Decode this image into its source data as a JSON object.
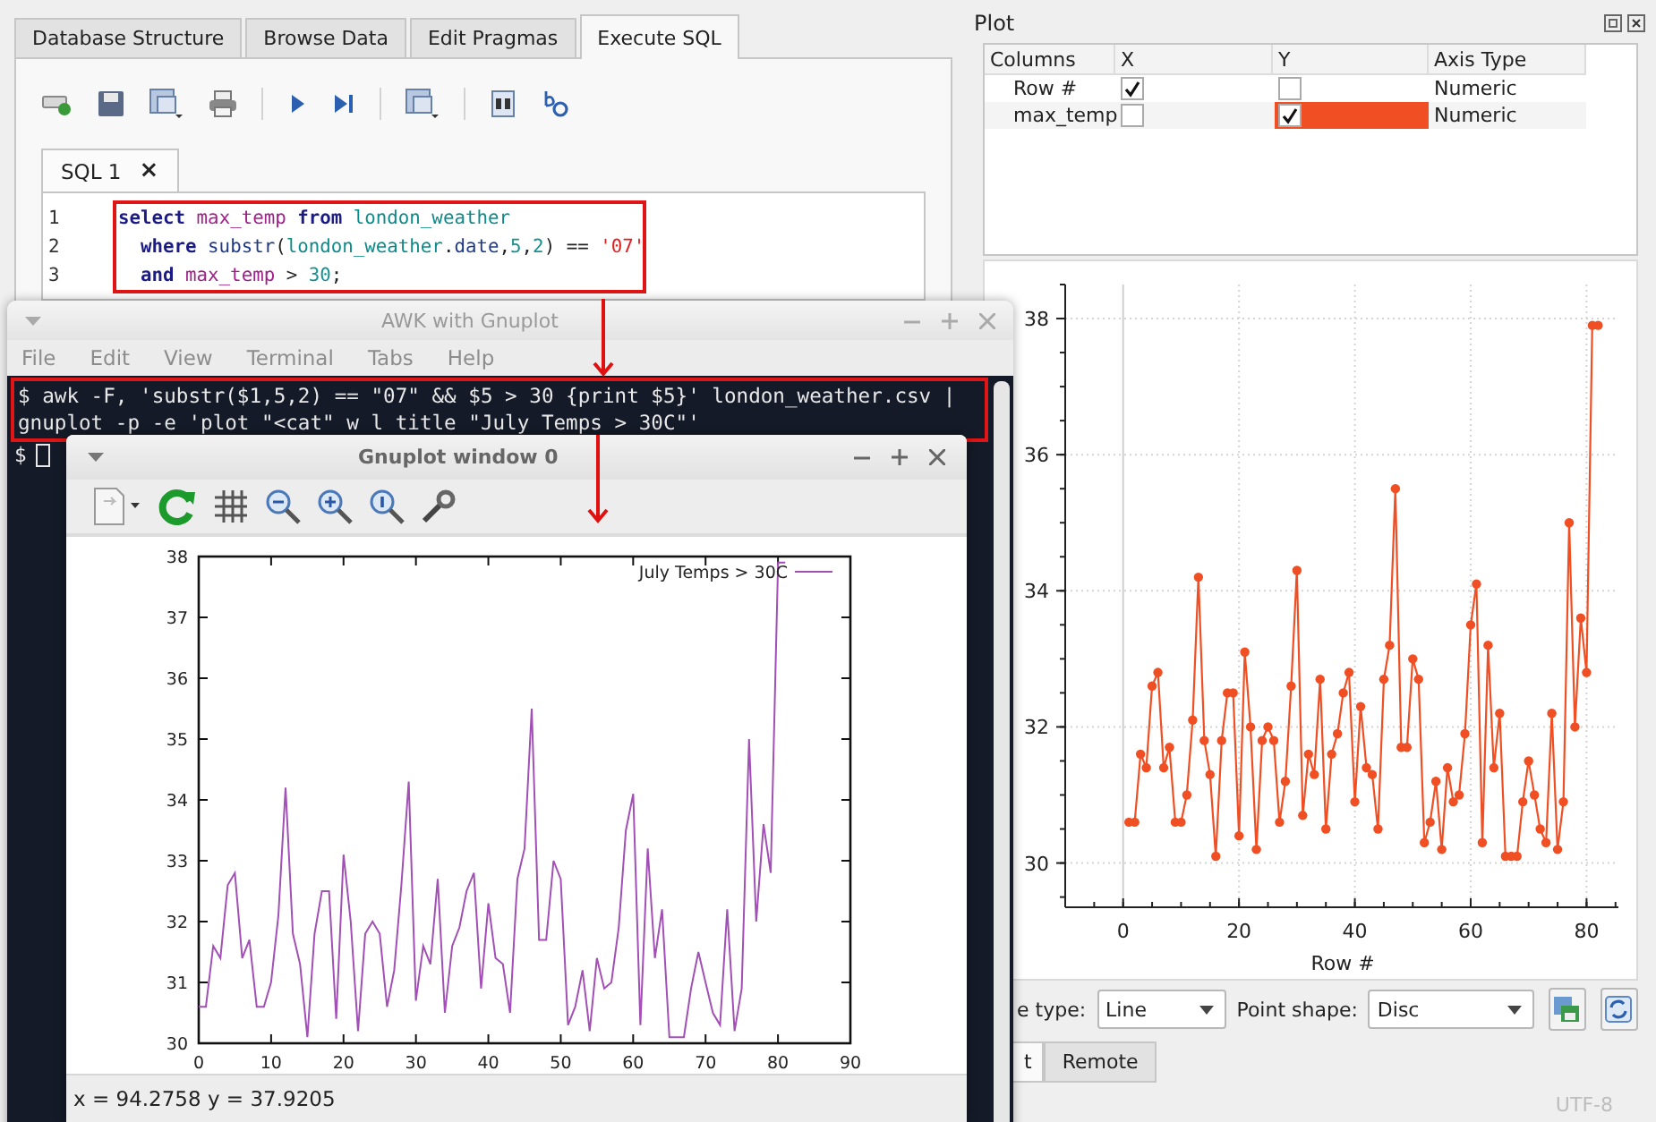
{
  "main_window": {
    "tabs": [
      {
        "label": "Database Structure",
        "selected": false
      },
      {
        "label": "Browse Data",
        "selected": false
      },
      {
        "label": "Edit Pragmas",
        "selected": false
      },
      {
        "label": "Execute SQL",
        "selected": true
      }
    ],
    "editor_tabs": [
      {
        "label": "SQL 1",
        "close": "×",
        "selected": true
      }
    ],
    "code_lines": [
      {
        "number": "1",
        "tokens": [
          {
            "kind": "keyword",
            "text": "select"
          },
          {
            "kind": "column",
            "text": " max_temp"
          },
          {
            "kind": "keyword",
            "text": " from"
          },
          {
            "kind": "table",
            "text": " london_weather"
          }
        ]
      },
      {
        "number": "2",
        "tokens": [
          {
            "kind": "keyword",
            "text": "  where"
          },
          {
            "kind": "function",
            "text": " substr"
          },
          {
            "kind": "plain",
            "text": "("
          },
          {
            "kind": "table",
            "text": "london_weather"
          },
          {
            "kind": "plain",
            "text": "."
          },
          {
            "kind": "function",
            "text": "date"
          },
          {
            "kind": "plain",
            "text": ","
          },
          {
            "kind": "number",
            "text": "5"
          },
          {
            "kind": "plain",
            "text": ","
          },
          {
            "kind": "number",
            "text": "2"
          },
          {
            "kind": "plain",
            "text": ") == "
          },
          {
            "kind": "string",
            "text": "'07'"
          }
        ]
      },
      {
        "number": "3",
        "tokens": [
          {
            "kind": "keyword",
            "text": "  and"
          },
          {
            "kind": "column",
            "text": " max_temp"
          },
          {
            "kind": "plain",
            "text": " > "
          },
          {
            "kind": "number",
            "text": "30"
          },
          {
            "kind": "plain",
            "text": ";"
          }
        ]
      }
    ]
  },
  "plot_dock": {
    "title": "Plot",
    "table": {
      "columns": [
        "Columns",
        "X",
        "Y",
        "Axis Type"
      ],
      "rows": [
        {
          "name": "Row #",
          "x_checked": true,
          "y_checked": false,
          "axis_type": "Numeric"
        },
        {
          "name": "max_temp",
          "x_checked": false,
          "y_checked": true,
          "axis_type": "Numeric",
          "color": "#f04e23"
        }
      ]
    },
    "chart_data": {
      "type": "line",
      "xlabel": "Row #",
      "x": [
        1,
        2,
        3,
        4,
        5,
        6,
        7,
        8,
        9,
        10,
        11,
        12,
        13,
        14,
        15,
        16,
        17,
        18,
        19,
        20,
        21,
        22,
        23,
        24,
        25,
        26,
        27,
        28,
        29,
        30,
        31,
        32,
        33,
        34,
        35,
        36,
        37,
        38,
        39,
        40,
        41,
        42,
        43,
        44,
        45,
        46,
        47,
        48,
        49,
        50,
        51,
        52,
        53,
        54,
        55,
        56,
        57,
        58,
        59,
        60,
        61,
        62,
        63,
        64,
        65,
        66,
        67,
        68,
        69,
        70,
        71,
        72,
        73,
        74,
        75,
        76,
        77,
        78,
        79,
        80,
        81,
        82
      ],
      "grid": true,
      "series": [
        {
          "color": "#f04e23",
          "marker": "circle",
          "values": [
            30.6,
            30.6,
            31.6,
            31.4,
            32.6,
            32.8,
            31.4,
            31.7,
            30.6,
            30.6,
            31.0,
            32.1,
            34.2,
            31.8,
            31.3,
            30.1,
            31.8,
            32.5,
            32.5,
            30.4,
            33.1,
            32.0,
            30.2,
            31.8,
            32.0,
            31.8,
            30.6,
            31.2,
            32.6,
            34.3,
            30.7,
            31.6,
            31.3,
            32.7,
            30.5,
            31.6,
            31.9,
            32.5,
            32.8,
            30.9,
            32.3,
            31.4,
            31.3,
            30.5,
            32.7,
            33.2,
            35.5,
            31.7,
            31.7,
            33.0,
            32.7,
            30.3,
            30.6,
            31.2,
            30.2,
            31.4,
            30.9,
            31.0,
            31.9,
            33.5,
            34.1,
            30.3,
            33.2,
            31.4,
            32.2,
            30.1,
            30.1,
            30.1,
            30.9,
            31.5,
            31.0,
            30.5,
            30.3,
            32.2,
            30.2,
            30.9,
            35.0,
            32.0,
            33.6,
            32.8,
            37.9,
            37.9
          ]
        }
      ],
      "xlim": [
        -10,
        85.5
      ],
      "ylim": [
        29.35,
        38.5
      ],
      "xticks": [
        0,
        20,
        40,
        60,
        80
      ],
      "yticks": [
        30,
        32,
        34,
        36,
        38
      ]
    },
    "line_type": {
      "label": "e type:",
      "value": "Line"
    },
    "point_shape": {
      "label": "Point shape:",
      "value": "Disc"
    },
    "tabs": [
      {
        "label": "t",
        "selected": true
      },
      {
        "label": "Remote",
        "selected": false
      }
    ],
    "encoding": "UTF-8"
  },
  "terminal_window": {
    "title": "AWK with Gnuplot",
    "menu": [
      "File",
      "Edit",
      "View",
      "Terminal",
      "Tabs",
      "Help"
    ],
    "command_lines": [
      "$ awk -F, 'substr($1,5,2) == \"07\" && $5 > 30 {print $5}' london_weather.csv |",
      "gnuplot -p -e 'plot \"<cat\" w l title \"July Temps > 30C\"'"
    ],
    "prompt": "$"
  },
  "gnuplot_window": {
    "title": "Gnuplot window 0",
    "chart_data": {
      "type": "line",
      "x": [
        0,
        1,
        2,
        3,
        4,
        5,
        6,
        7,
        8,
        9,
        10,
        11,
        12,
        13,
        14,
        15,
        16,
        17,
        18,
        19,
        20,
        21,
        22,
        23,
        24,
        25,
        26,
        27,
        28,
        29,
        30,
        31,
        32,
        33,
        34,
        35,
        36,
        37,
        38,
        39,
        40,
        41,
        42,
        43,
        44,
        45,
        46,
        47,
        48,
        49,
        50,
        51,
        52,
        53,
        54,
        55,
        56,
        57,
        58,
        59,
        60,
        61,
        62,
        63,
        64,
        65,
        66,
        67,
        68,
        69,
        70,
        71,
        72,
        73,
        74,
        75,
        76,
        77,
        78,
        79,
        80,
        81
      ],
      "series": [
        {
          "name": "July Temps > 30C",
          "color": "#a24fb6",
          "values": [
            30.6,
            30.6,
            31.6,
            31.4,
            32.6,
            32.8,
            31.4,
            31.7,
            30.6,
            30.6,
            31.0,
            32.1,
            34.2,
            31.8,
            31.3,
            30.1,
            31.8,
            32.5,
            32.5,
            30.4,
            33.1,
            32.0,
            30.2,
            31.8,
            32.0,
            31.8,
            30.6,
            31.2,
            32.6,
            34.3,
            30.7,
            31.6,
            31.3,
            32.7,
            30.5,
            31.6,
            31.9,
            32.5,
            32.8,
            30.9,
            32.3,
            31.4,
            31.3,
            30.5,
            32.7,
            33.2,
            35.5,
            31.7,
            31.7,
            33.0,
            32.7,
            30.3,
            30.6,
            31.2,
            30.2,
            31.4,
            30.9,
            31.0,
            31.9,
            33.5,
            34.1,
            30.3,
            33.2,
            31.4,
            32.2,
            30.1,
            30.1,
            30.1,
            30.9,
            31.5,
            31.0,
            30.5,
            30.3,
            32.2,
            30.2,
            30.9,
            35.0,
            32.0,
            33.6,
            32.8,
            37.9,
            37.9
          ]
        }
      ],
      "xlim": [
        0,
        90
      ],
      "ylim": [
        30,
        38
      ],
      "xticks": [
        0,
        10,
        20,
        30,
        40,
        50,
        60,
        70,
        80,
        90
      ],
      "yticks": [
        30,
        31,
        32,
        33,
        34,
        35,
        36,
        37,
        38
      ]
    },
    "status": "x = 94.2758 y = 37.9205"
  }
}
